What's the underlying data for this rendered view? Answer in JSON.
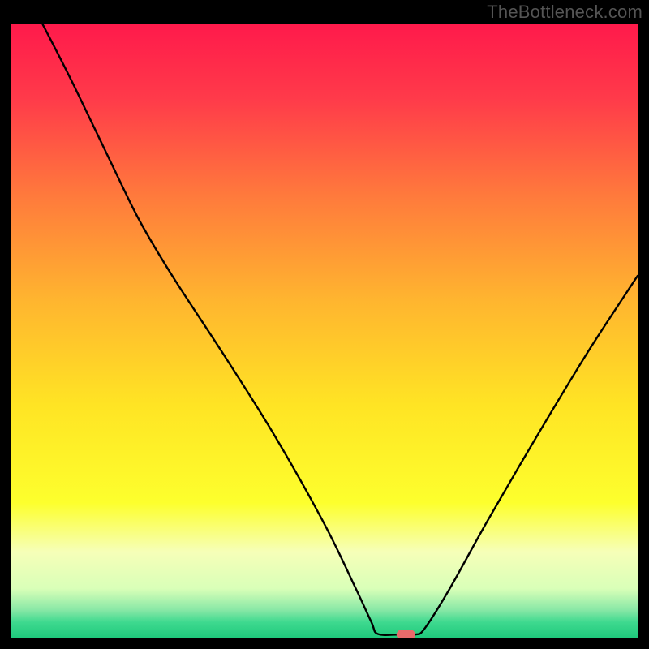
{
  "watermark": "TheBottleneck.com",
  "chart_data": {
    "type": "line",
    "title": "",
    "xlabel": "",
    "ylabel": "",
    "xlim": [
      0,
      100
    ],
    "ylim": [
      0,
      100
    ],
    "grid": false,
    "background": {
      "type": "vertical-gradient",
      "stops": [
        {
          "offset": 0.0,
          "color": "#ff1a4b"
        },
        {
          "offset": 0.12,
          "color": "#ff3a4a"
        },
        {
          "offset": 0.28,
          "color": "#ff7a3c"
        },
        {
          "offset": 0.45,
          "color": "#ffb52f"
        },
        {
          "offset": 0.62,
          "color": "#ffe424"
        },
        {
          "offset": 0.78,
          "color": "#fdff2d"
        },
        {
          "offset": 0.86,
          "color": "#f6ffb8"
        },
        {
          "offset": 0.92,
          "color": "#d9ffb8"
        },
        {
          "offset": 0.955,
          "color": "#88e8a6"
        },
        {
          "offset": 0.975,
          "color": "#3ed98f"
        },
        {
          "offset": 1.0,
          "color": "#1fc97c"
        }
      ]
    },
    "series": [
      {
        "name": "bottleneck-curve",
        "stroke": "#000000",
        "stroke_width": 2.4,
        "points": [
          {
            "x": 5.0,
            "y": 100.0
          },
          {
            "x": 10.0,
            "y": 90.0
          },
          {
            "x": 18.0,
            "y": 73.0
          },
          {
            "x": 21.0,
            "y": 67.0
          },
          {
            "x": 26.0,
            "y": 58.5
          },
          {
            "x": 34.0,
            "y": 46.0
          },
          {
            "x": 42.0,
            "y": 33.0
          },
          {
            "x": 50.0,
            "y": 18.5
          },
          {
            "x": 55.0,
            "y": 8.0
          },
          {
            "x": 57.5,
            "y": 2.5
          },
          {
            "x": 58.5,
            "y": 0.6
          },
          {
            "x": 62.0,
            "y": 0.5
          },
          {
            "x": 64.5,
            "y": 0.5
          },
          {
            "x": 66.0,
            "y": 1.5
          },
          {
            "x": 70.0,
            "y": 8.0
          },
          {
            "x": 76.0,
            "y": 19.0
          },
          {
            "x": 84.0,
            "y": 33.0
          },
          {
            "x": 92.0,
            "y": 46.5
          },
          {
            "x": 100.0,
            "y": 59.0
          }
        ]
      }
    ],
    "marker": {
      "name": "optimal-point",
      "x": 63.0,
      "y": 0.5,
      "color": "#e86a6a",
      "shape": "rounded-pill",
      "width": 3.0,
      "height": 1.5
    }
  }
}
